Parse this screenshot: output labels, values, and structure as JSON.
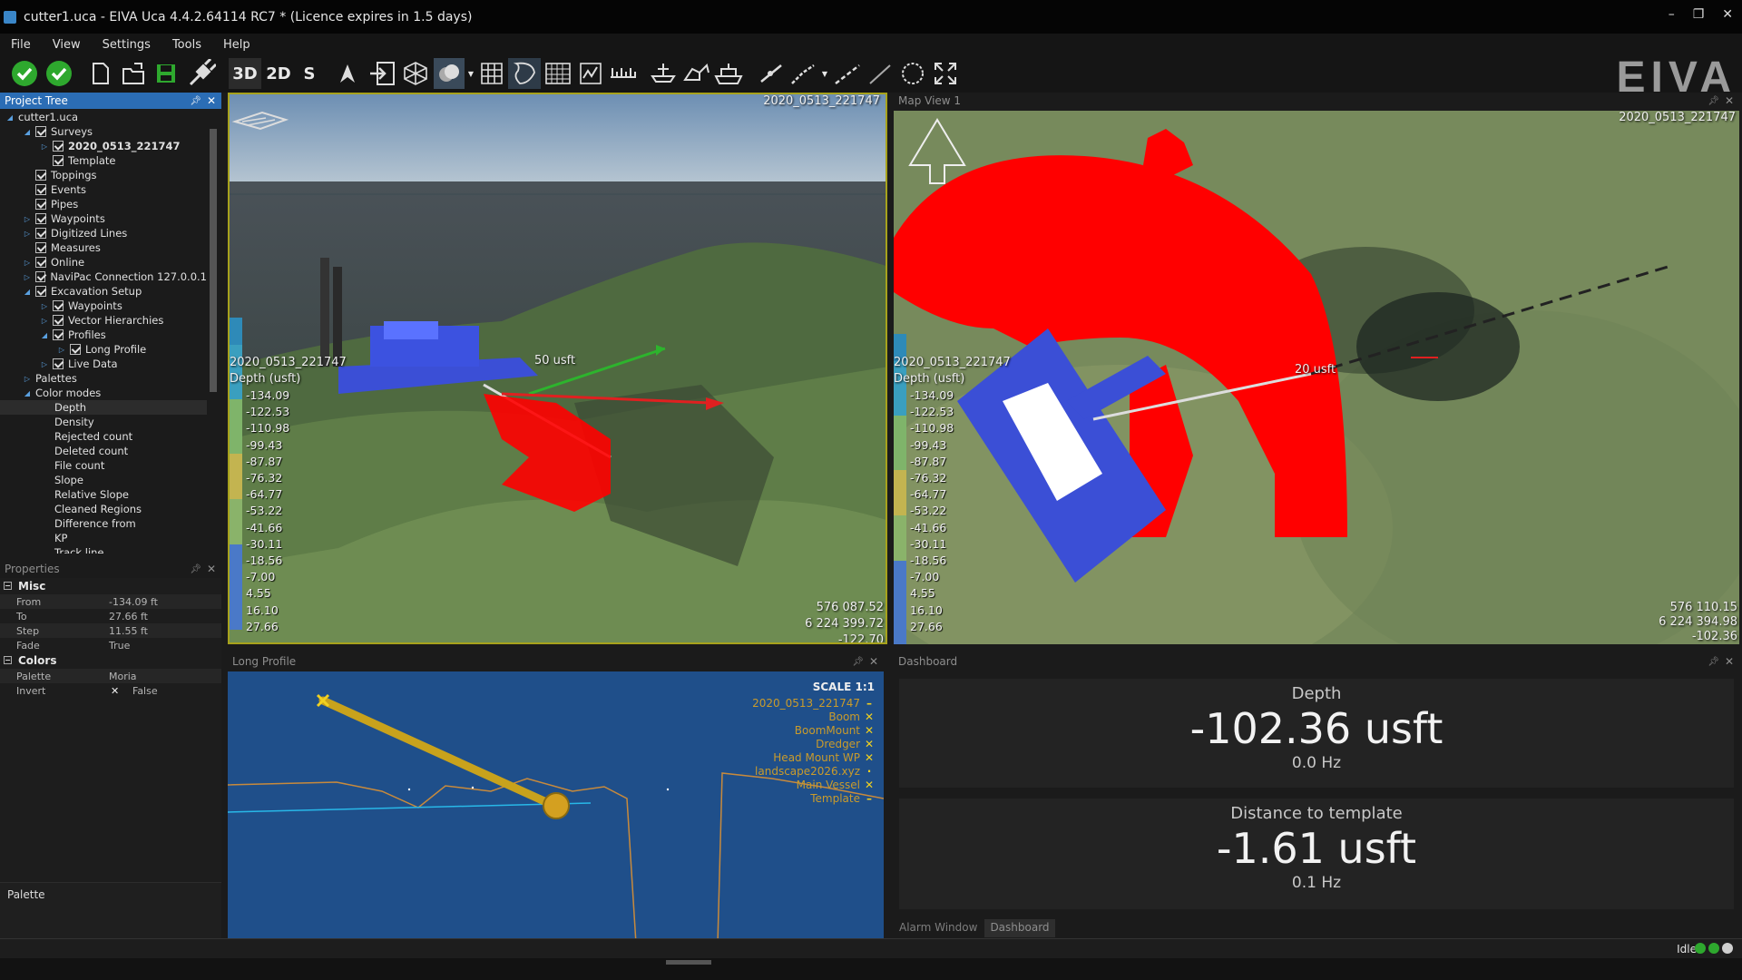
{
  "window": {
    "title": "cutter1.uca - EIVA Uca 4.4.2.64114 RC7 * (Licence expires in 1.5 days)",
    "buttons": [
      "–",
      "❐",
      "✕"
    ]
  },
  "menu": [
    "File",
    "View",
    "Settings",
    "Tools",
    "Help"
  ],
  "toolbar": {
    "modes": [
      "3D",
      "2D",
      "S"
    ],
    "logo": "EIVA"
  },
  "project_tree": {
    "header": "Project Tree",
    "nodes": [
      {
        "label": "cutter1.uca",
        "level": 0,
        "arrow": "◢",
        "check": false
      },
      {
        "label": "Surveys",
        "level": 1,
        "arrow": "◢",
        "check": true
      },
      {
        "label": "2020_0513_221747",
        "level": 2,
        "arrow": "▷",
        "check": true,
        "bold": true
      },
      {
        "label": "Template",
        "level": 2,
        "arrow": "",
        "check": true
      },
      {
        "label": "Toppings",
        "level": 1,
        "arrow": "",
        "check": true
      },
      {
        "label": "Events",
        "level": 1,
        "arrow": "",
        "check": true
      },
      {
        "label": "Pipes",
        "level": 1,
        "arrow": "",
        "check": true
      },
      {
        "label": "Waypoints",
        "level": 1,
        "arrow": "▷",
        "check": true
      },
      {
        "label": "Digitized Lines",
        "level": 1,
        "arrow": "▷",
        "check": true
      },
      {
        "label": "Measures",
        "level": 1,
        "arrow": "",
        "check": true
      },
      {
        "label": "Online",
        "level": 1,
        "arrow": "▷",
        "check": true
      },
      {
        "label": "NaviPac Connection 127.0.0.1",
        "level": 1,
        "arrow": "▷",
        "check": true
      },
      {
        "label": "Excavation Setup",
        "level": 1,
        "arrow": "◢",
        "check": true
      },
      {
        "label": "Waypoints",
        "level": 2,
        "arrow": "▷",
        "check": true
      },
      {
        "label": "Vector Hierarchies",
        "level": 2,
        "arrow": "▷",
        "check": true
      },
      {
        "label": "Profiles",
        "level": 2,
        "arrow": "◢",
        "check": true
      },
      {
        "label": "Long Profile",
        "level": 3,
        "arrow": "▷",
        "check": true
      },
      {
        "label": "Live Data",
        "level": 2,
        "arrow": "▷",
        "check": true
      },
      {
        "label": "Palettes",
        "level": 1,
        "arrow": "▷",
        "check": false
      },
      {
        "label": "Color modes",
        "level": 1,
        "arrow": "◢",
        "check": false
      },
      {
        "label": "Depth",
        "level": 2,
        "arrow": "",
        "check": false,
        "sel": true
      },
      {
        "label": "Density",
        "level": 2,
        "arrow": "",
        "check": false
      },
      {
        "label": "Rejected count",
        "level": 2,
        "arrow": "",
        "check": false
      },
      {
        "label": "Deleted count",
        "level": 2,
        "arrow": "",
        "check": false
      },
      {
        "label": "File count",
        "level": 2,
        "arrow": "",
        "check": false
      },
      {
        "label": "Slope",
        "level": 2,
        "arrow": "",
        "check": false
      },
      {
        "label": "Relative Slope",
        "level": 2,
        "arrow": "",
        "check": false
      },
      {
        "label": "Cleaned Regions",
        "level": 2,
        "arrow": "",
        "check": false
      },
      {
        "label": "Difference from",
        "level": 2,
        "arrow": "",
        "check": false
      },
      {
        "label": "KP",
        "level": 2,
        "arrow": "",
        "check": false
      },
      {
        "label": "Track line",
        "level": 2,
        "arrow": "",
        "check": false
      }
    ]
  },
  "properties": {
    "header": "Properties",
    "misc_label": "Misc",
    "misc": [
      {
        "k": "From",
        "v": "-134.09 ft"
      },
      {
        "k": "To",
        "v": "27.66 ft"
      },
      {
        "k": "Step",
        "v": "11.55 ft"
      },
      {
        "k": "Fade",
        "v": "True"
      }
    ],
    "colors_label": "Colors",
    "colors": [
      {
        "k": "Palette",
        "v": "Moria"
      },
      {
        "k": "Invert",
        "v": "False",
        "mark": "✕"
      }
    ],
    "palette_section": "Palette"
  },
  "view3d": {
    "survey_top": "2020_0513_221747",
    "survey_left": "2020_0513_221747",
    "depth_title": "Depth (usft)",
    "range_label": "50 usft",
    "coords": [
      "576 087.52",
      "6 224 399.72",
      "-122.70"
    ]
  },
  "mapview": {
    "header": "Map View 1",
    "survey_top": "2020_0513_221747",
    "survey_left": "2020_0513_221747",
    "depth_title": "Depth (usft)",
    "range_label": "20 usft",
    "coords": [
      "576 110.15",
      "6 224 394.98",
      "-102.36"
    ]
  },
  "depth_legend": [
    "-134.09",
    "-122.53",
    "-110.98",
    "-99.43",
    "-87.87",
    "-76.32",
    "-64.77",
    "-53.22",
    "-41.66",
    "-30.11",
    "-18.56",
    "-7.00",
    "4.55",
    "16.10",
    "27.66"
  ],
  "long_profile": {
    "header": "Long Profile",
    "scale": "SCALE 1:1",
    "legend": [
      {
        "name": "2020_0513_221747",
        "mark": "–"
      },
      {
        "name": "Boom",
        "mark": "✕"
      },
      {
        "name": "BoomMount",
        "mark": "✕"
      },
      {
        "name": "Dredger",
        "mark": "✕"
      },
      {
        "name": "Head Mount WP",
        "mark": "✕"
      },
      {
        "name": "landscape2026.xyz",
        "mark": "·"
      },
      {
        "name": "Main Vessel",
        "mark": "✕"
      },
      {
        "name": "Template",
        "mark": "–"
      }
    ]
  },
  "dashboard": {
    "header": "Dashboard",
    "cards": [
      {
        "title": "Depth",
        "value": "-102.36 usft",
        "rate": "0.0 Hz"
      },
      {
        "title": "Distance to template",
        "value": "-1.61 usft",
        "rate": "0.1 Hz"
      }
    ],
    "tabs": [
      "Alarm Window",
      "Dashboard"
    ]
  },
  "status": {
    "text": "Idle"
  },
  "colors": {
    "accent": "#2b6db5",
    "active_border": "#a7a21c",
    "excavation": "#ff0000",
    "vessel": "#3b4fd6",
    "profile_bg": "#1f4f8a",
    "boom": "#c8a21c"
  }
}
